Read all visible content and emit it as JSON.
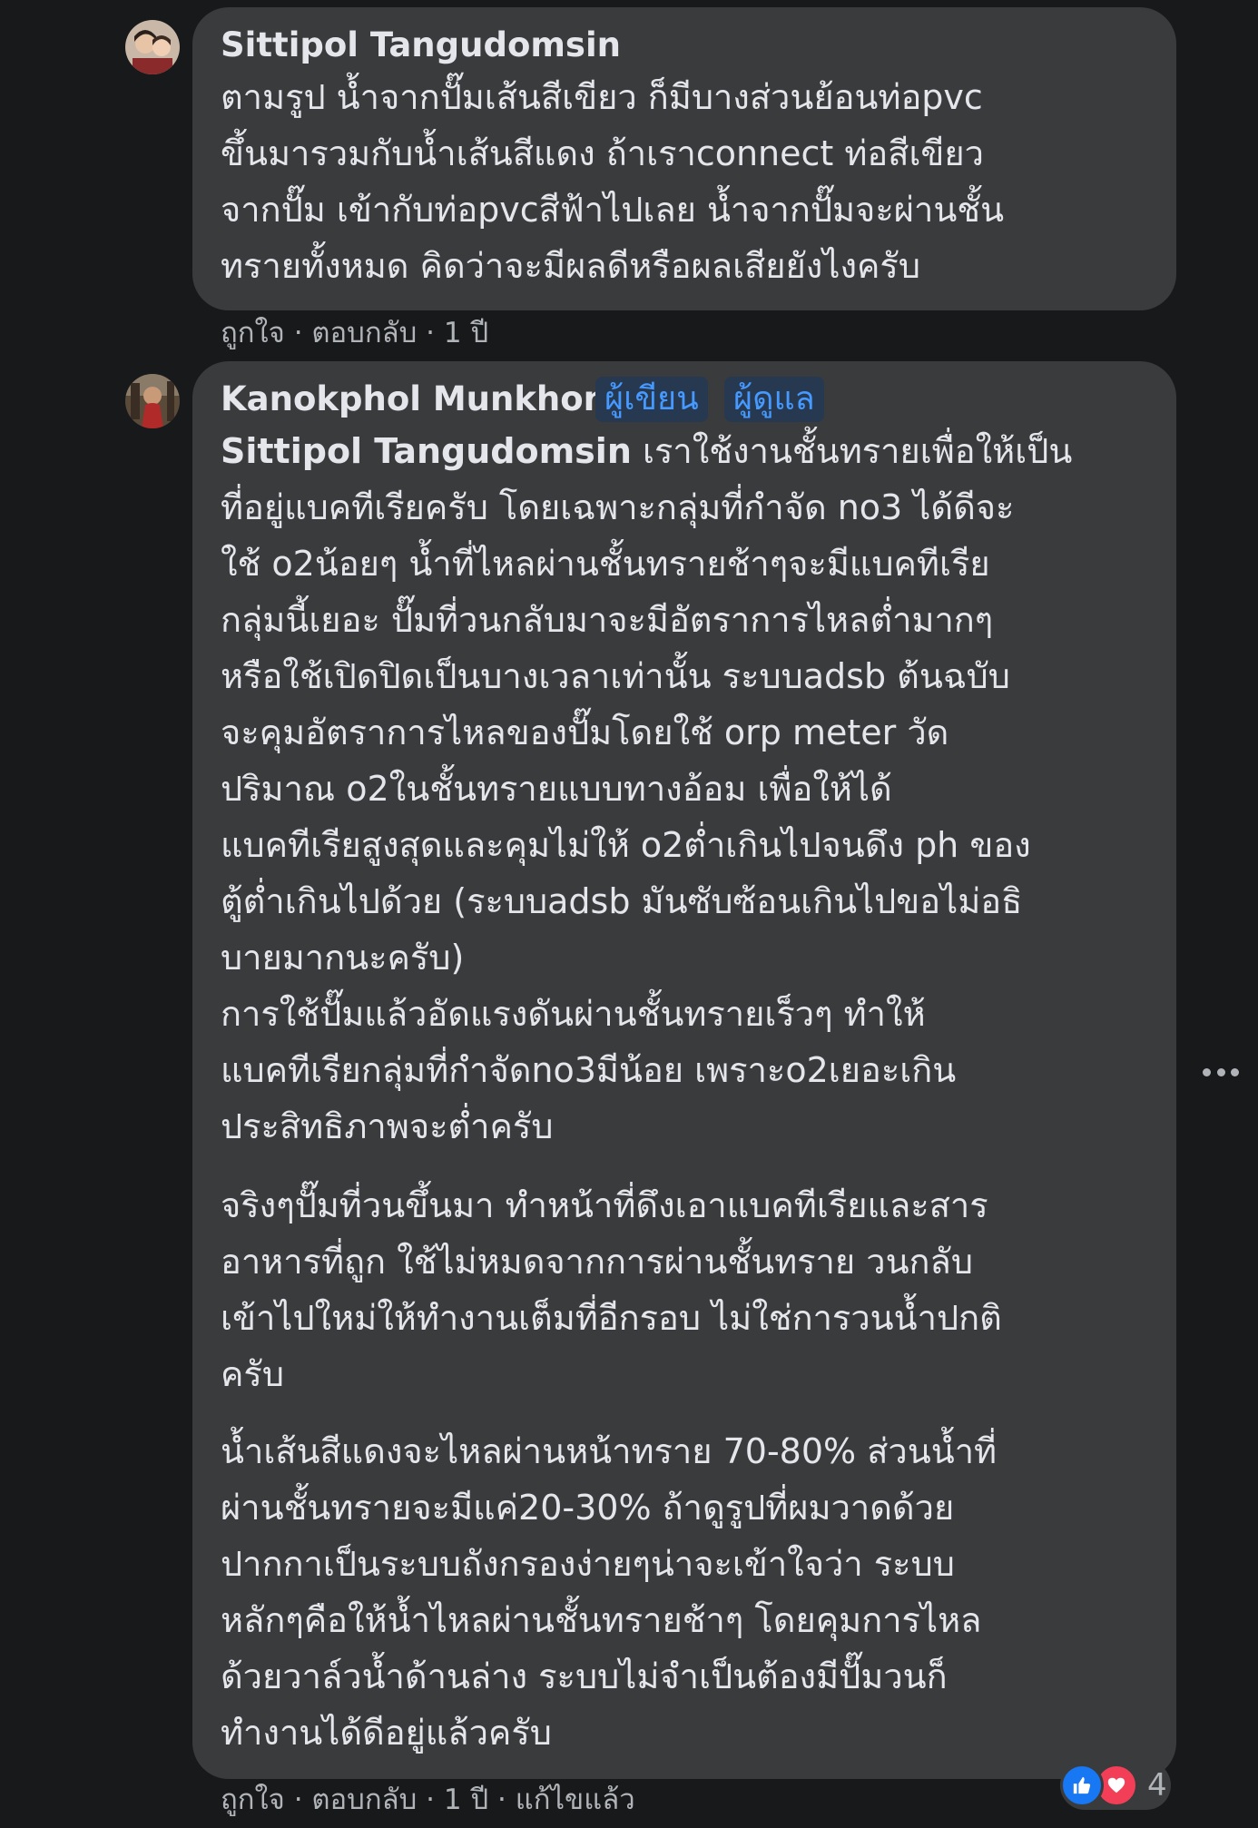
{
  "comments": [
    {
      "author": "Sittipol Tangudomsin",
      "lines": [
        "ตามรูป น้ำจากปั๊มเส้นสีเขียว ก็มีบางส่วนย้อนท่อpvc",
        "ขึ้นมารวมกับน้ำเส้นสีแดง ถ้าเราconnect ท่อสีเขียว",
        "จากปั๊ม เข้ากับท่อpvcสีฟ้าไปเลย น้ำจากปั๊มจะผ่านชั้น",
        "ทรายทั้งหมด คิดว่าจะมีผลดีหรือผลเสียยังไงครับ"
      ],
      "actions": {
        "like": "ถูกใจ",
        "reply": "ตอบกลับ",
        "time": "1 ปี"
      }
    },
    {
      "author": "Kanokphol Munkhong",
      "badges": [
        "ผู้เขียน",
        "ผู้ดูแล"
      ],
      "mention": "Sittipol Tangudomsin",
      "first_line_rest": " เราใช้งานชั้นทรายเพื่อให้เป็น",
      "lines": [
        "ที่อยู่แบคทีเรียครับ โดยเฉพาะกลุ่มที่กำจัด no3 ได้ดีจะ",
        "ใช้ o2น้อยๆ น้ำที่ไหลผ่านชั้นทรายช้าๆจะมีแบคทีเรีย",
        "กลุ่มนี้เยอะ ปั๊มที่วนกลับมาจะมีอัตราการไหลต่ำมากๆ",
        "หรือใช้เปิดปิดเป็นบางเวลาเท่านั้น ระบบadsb ต้นฉบับ",
        "จะคุมอัตราการไหลของปั๊มโดยใช้ orp meter วัด",
        "ปริมาณ o2ในชั้นทรายแบบทางอ้อม เพื่อให้ได้",
        "แบคทีเรียสูงสุดและคุมไม่ให้ o2ต่ำเกินไปจนดึง ph ของ",
        "ตู้ต่ำเกินไปด้วย (ระบบadsb มันซับซ้อนเกินไปขอไม่อธิ",
        "บายมากนะครับ)",
        "การใช้ปั๊มแล้วอัดแรงดันผ่านชั้นทรายเร็วๆ ทำให้",
        "แบคทีเรียกลุ่มที่กำจัดno3มีน้อย เพราะo2เยอะเกิน",
        "ประสิทธิภาพจะต่ำครับ"
      ],
      "paragraph2": [
        "จริงๆปั๊มที่วนขึ้นมา ทำหน้าที่ดึงเอาแบคทีเรียและสาร",
        "อาหารที่ถูก ใช้ไม่หมดจากการผ่านชั้นทราย วนกลับ",
        "เข้าไปใหม่ให้ทำงานเต็มที่อีกรอบ ไม่ใช่การวนน้ำปกติ",
        "ครับ"
      ],
      "paragraph3": [
        "น้ำเส้นสีแดงจะไหลผ่านหน้าทราย 70-80% ส่วนน้ำที่",
        "ผ่านชั้นทรายจะมีแค่20-30% ถ้าดูรูปที่ผมวาดด้วย",
        "ปากกาเป็นระบบถังกรองง่ายๆน่าจะเข้าใจว่า ระบบ",
        "หลักๆคือให้น้ำไหลผ่านชั้นทรายช้าๆ โดยคุมการไหล",
        "ด้วยวาล์วน้ำด้านล่าง ระบบไม่จำเป็นต้องมีปั๊มวนก็",
        "ทำงานได้ดีอยู่แล้วครับ"
      ],
      "actions": {
        "like": "ถูกใจ",
        "reply": "ตอบกลับ",
        "time": "1 ปี",
        "edited": "แก้ไขแล้ว"
      },
      "reactions": {
        "count": "4",
        "icons": [
          "like-icon",
          "love-icon"
        ]
      }
    }
  ],
  "colors": {
    "background": "#18191a",
    "bubble": "#3a3b3c",
    "text": "#e4e6eb",
    "secondary": "#b0b3b8",
    "badge_text": "#4599ff",
    "badge_bg": "#263951",
    "like": "#1877f2",
    "love": "#f33e58"
  }
}
